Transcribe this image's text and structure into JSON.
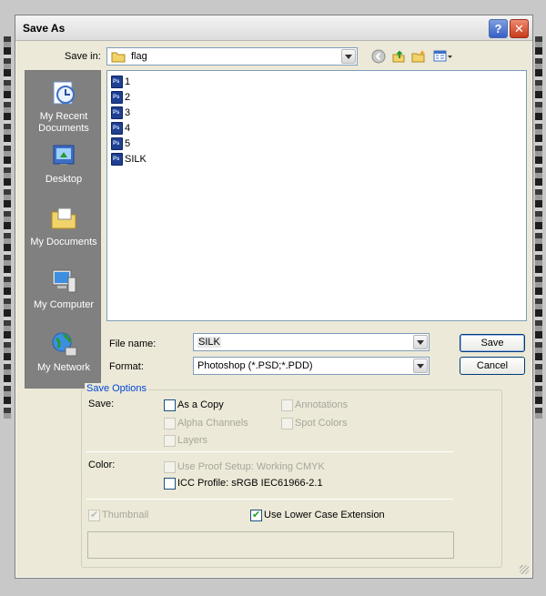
{
  "window": {
    "title": "Save As"
  },
  "titlebar": {
    "help_label": "?",
    "close_label": "✕"
  },
  "toolbar": {
    "save_in_label": "Save in:",
    "save_in_value": "flag",
    "icons": [
      "back-icon",
      "up-folder-icon",
      "new-folder-icon",
      "views-menu-icon"
    ]
  },
  "places": [
    {
      "label": "My Recent Documents",
      "icon": "recent-documents-icon"
    },
    {
      "label": "Desktop",
      "icon": "desktop-icon"
    },
    {
      "label": "My Documents",
      "icon": "my-documents-icon"
    },
    {
      "label": "My Computer",
      "icon": "my-computer-icon"
    },
    {
      "label": "My Network",
      "icon": "my-network-icon"
    }
  ],
  "files": [
    "1",
    "2",
    "3",
    "4",
    "5",
    "SILK"
  ],
  "form": {
    "file_name_label": "File name:",
    "file_name_value": "SILK",
    "format_label": "Format:",
    "format_value": "Photoshop (*.PSD;*.PDD)",
    "save_button": "Save",
    "cancel_button": "Cancel"
  },
  "save_options": {
    "legend": "Save Options",
    "save_label": "Save:",
    "as_a_copy": {
      "label": "As a Copy",
      "checked": false,
      "enabled": true
    },
    "alpha_channels": {
      "label": "Alpha Channels",
      "checked": false,
      "enabled": false
    },
    "layers": {
      "label": "Layers",
      "checked": false,
      "enabled": false
    },
    "annotations": {
      "label": "Annotations",
      "checked": false,
      "enabled": false
    },
    "spot_colors": {
      "label": "Spot Colors",
      "checked": false,
      "enabled": false
    },
    "color_label": "Color:",
    "use_proof_setup": {
      "label": "Use Proof Setup:  Working CMYK",
      "checked": false,
      "enabled": false
    },
    "icc_profile": {
      "label": "ICC Profile:  sRGB IEC61966-2.1",
      "checked": false,
      "enabled": true
    },
    "thumbnail": {
      "label": "Thumbnail",
      "checked": true,
      "enabled": false
    },
    "lower_case_extension": {
      "label": "Use Lower Case Extension",
      "checked": true,
      "enabled": true
    }
  },
  "colors": {
    "dialog_bg": "#ece9d8",
    "accent_blue": "#0046d5",
    "places_bg": "#808080"
  }
}
